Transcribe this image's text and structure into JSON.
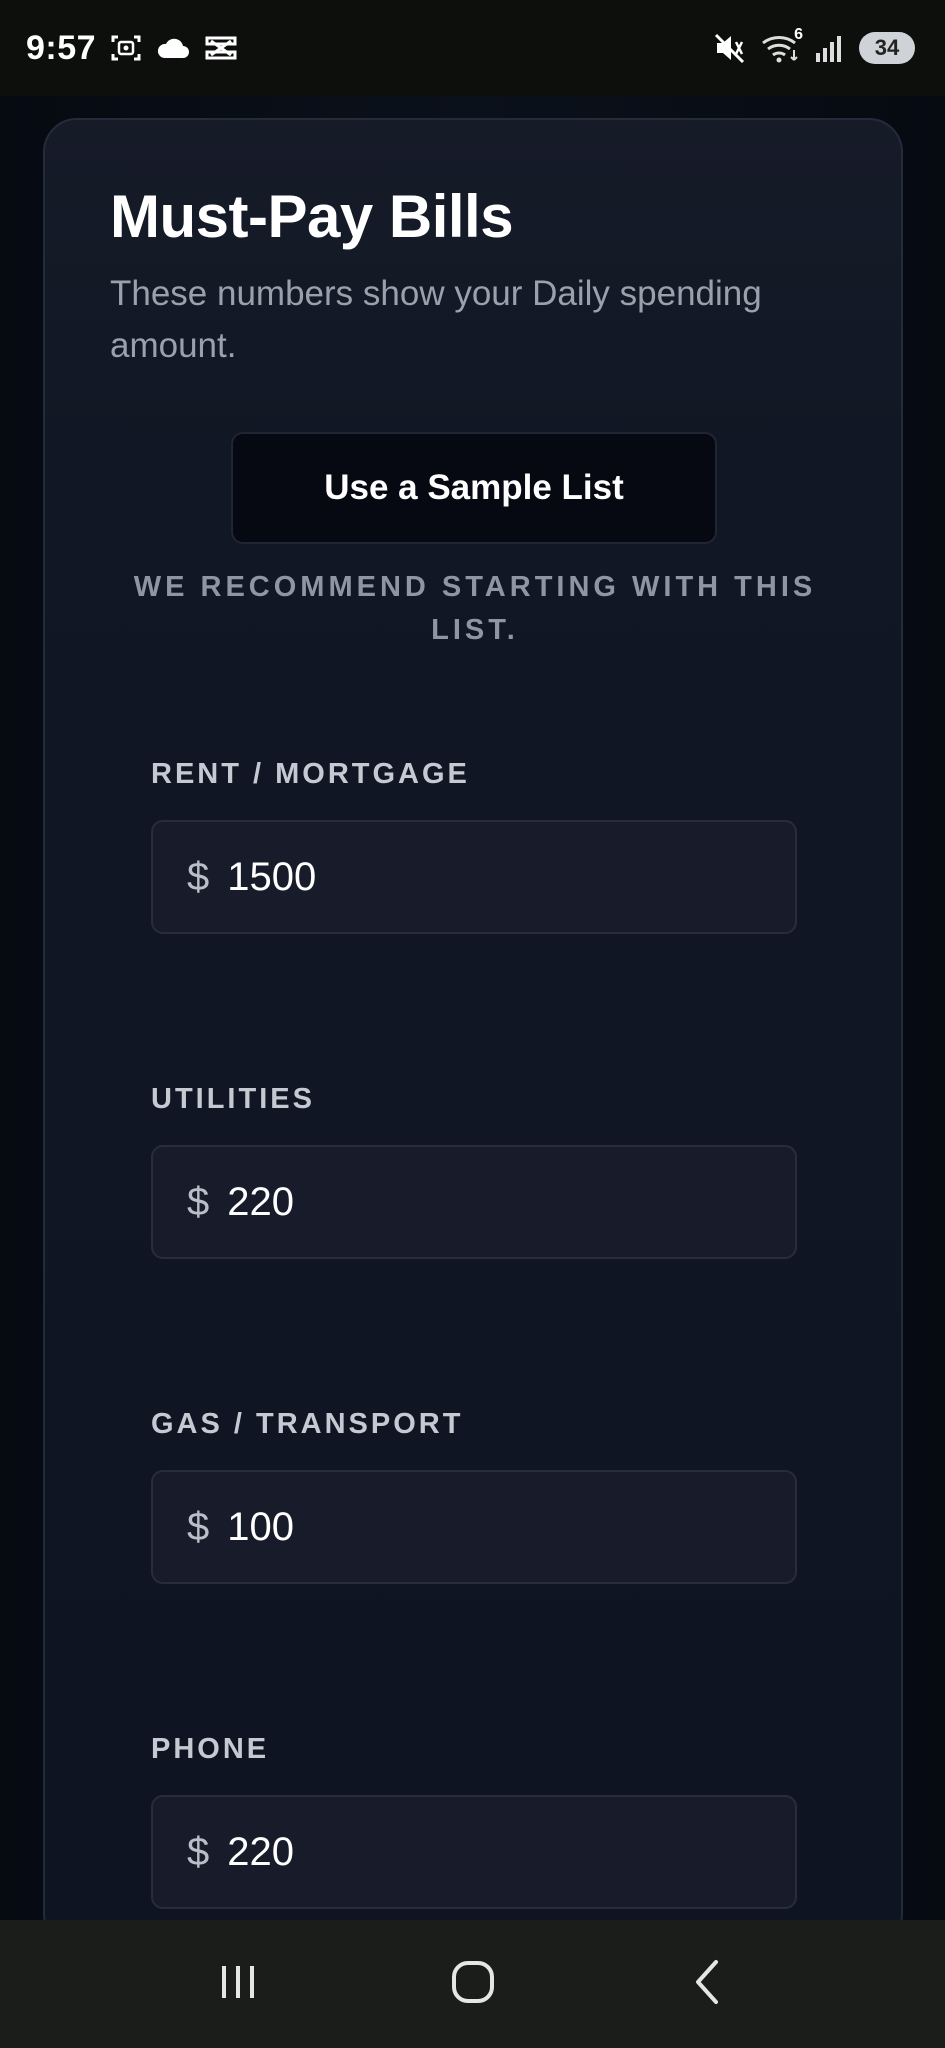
{
  "status_bar": {
    "time": "9:57",
    "left_icons": [
      "screenshot-icon",
      "cloud-icon",
      "capcut-icon"
    ],
    "right_icons": [
      "mute-icon",
      "wifi-icon",
      "signal-icon"
    ],
    "wifi_badge": "6",
    "battery": "34"
  },
  "card": {
    "title": "Must-Pay Bills",
    "subtitle": "These numbers show your Daily spending amount.",
    "sample_button_label": "Use a Sample List",
    "recommend_text": "WE RECOMMEND STARTING WITH THIS LIST."
  },
  "bills": [
    {
      "label": "RENT / MORTGAGE",
      "currency": "$",
      "value": "1500"
    },
    {
      "label": "UTILITIES",
      "currency": "$",
      "value": "220"
    },
    {
      "label": "GAS / TRANSPORT",
      "currency": "$",
      "value": "100"
    },
    {
      "label": "PHONE",
      "currency": "$",
      "value": "220"
    }
  ],
  "nav_bar": {
    "buttons": [
      "recents-icon",
      "home-icon",
      "back-icon"
    ]
  },
  "colors": {
    "background": "#070b12",
    "card": "#111724",
    "input": "#181c2a",
    "muted_text": "#8e96a3"
  }
}
